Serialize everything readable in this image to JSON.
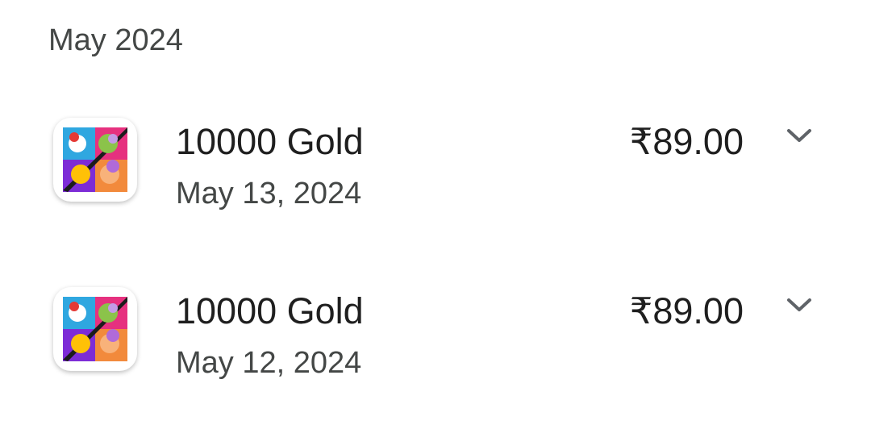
{
  "section": {
    "month_label": "May 2024"
  },
  "purchases": [
    {
      "icon": "game-app-icon",
      "title": "10000 Gold",
      "date": "May 13, 2024",
      "price": "₹89.00",
      "expand_icon": "chevron-down-icon"
    },
    {
      "icon": "game-app-icon",
      "title": "10000 Gold",
      "date": "May 12, 2024",
      "price": "₹89.00",
      "expand_icon": "chevron-down-icon"
    }
  ],
  "colors": {
    "primary_text": "#1f1f1f",
    "secondary_text": "#444746",
    "icon_gray": "#5f6368"
  }
}
